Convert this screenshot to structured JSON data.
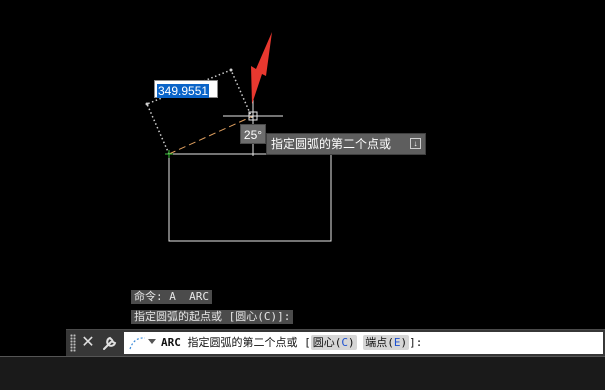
{
  "dynamic_input": {
    "distance_value": "349.9551"
  },
  "angle_readout": "25°",
  "tooltip": {
    "prompt": "指定圆弧的第二个点或",
    "toggle_glyph": "↓"
  },
  "command_history": [
    "命令: A  ARC",
    "指定圆弧的起点或 [圆心(C)]:"
  ],
  "command_line": {
    "command": "ARC",
    "prompt": "指定圆弧的第二个点或 [",
    "options": [
      {
        "label": "圆心",
        "key": "C"
      },
      {
        "label": "端点",
        "key": "E"
      }
    ],
    "suffix": "]:",
    "close_glyph": "✕"
  },
  "colors": {
    "background": "#000000",
    "geometry": "#ffffff",
    "rubberband": "#e0a060",
    "annotation_arrow": "#e8382f",
    "selection": "#0a64c8"
  }
}
